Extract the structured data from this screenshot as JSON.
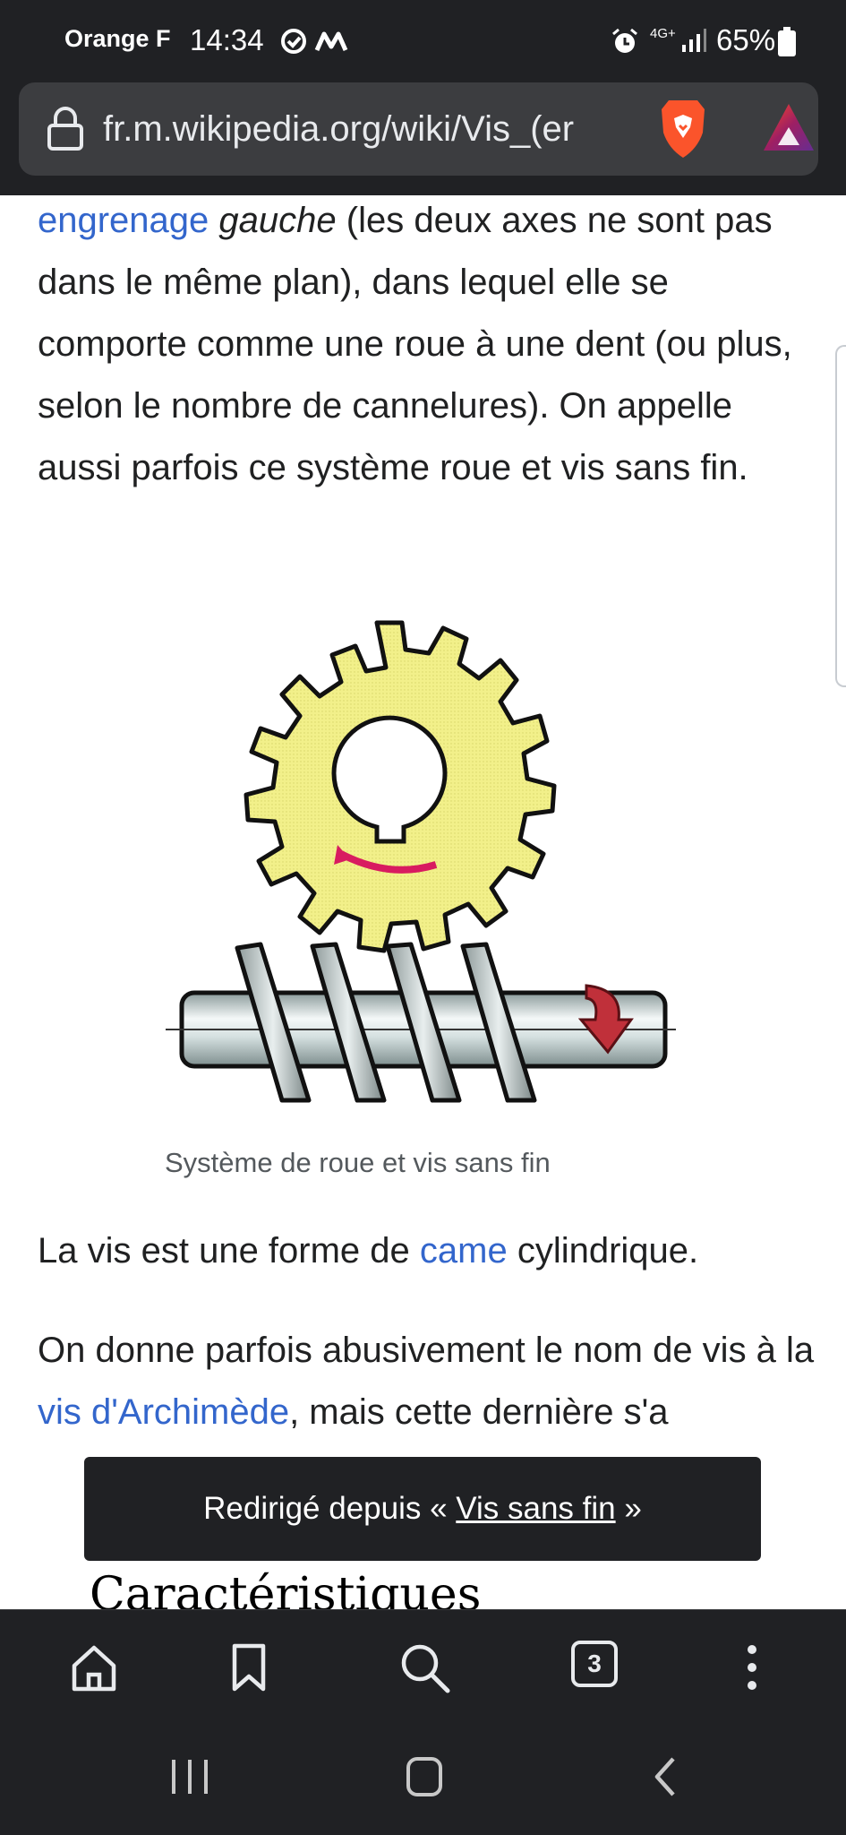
{
  "status_bar": {
    "carrier": "Orange F",
    "time": "14:34",
    "network": "4G+",
    "battery": "65%"
  },
  "browser": {
    "url": "fr.m.wikipedia.org/wiki/Vis_(er"
  },
  "article": {
    "para1": {
      "link_engrenage": "engrenage",
      "italic_gauche": "gauche",
      "text": " (les deux axes ne sont pas dans le même plan), dans lequel elle se comporte comme une roue à une dent (ou plus, selon le nombre de cannelures). On appelle aussi parfois ce système roue et vis sans fin."
    },
    "figure_caption": "Système de roue et vis sans fin",
    "para2": {
      "before": "La vis est une forme de ",
      "link_came": "came",
      "after": " cylindrique."
    },
    "para3": {
      "before": "On donne parfois abusivement le nom de vis à la ",
      "link_archimede": "vis d'Archimède",
      "after": ", mais cette dernière s'a"
    },
    "section_heading": "Caractéristiques"
  },
  "toast": {
    "prefix": "Redirigé depuis « ",
    "link": "Vis sans fin",
    "suffix": " »"
  },
  "toolbar": {
    "tab_count": "3"
  },
  "colors": {
    "chrome_bg": "#202124",
    "link": "#3366cc",
    "gear_fill": "#f0ef86",
    "arrow_red": "#c0303a",
    "gear_arrow": "#d81b60"
  }
}
